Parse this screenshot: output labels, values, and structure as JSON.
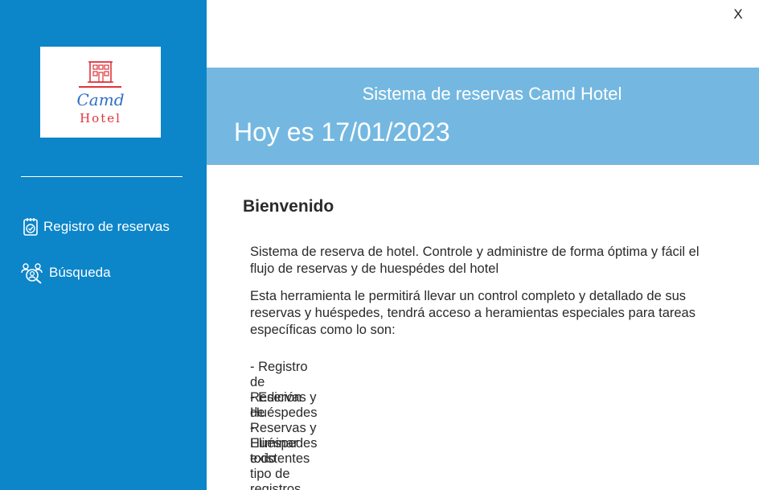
{
  "sidebar": {
    "logo": {
      "line1": "Camd",
      "line2": "Hotel"
    },
    "items": [
      {
        "label": "Registro de reservas",
        "icon": "clipboard-check-icon"
      },
      {
        "label": "Búsqueda",
        "icon": "users-search-icon"
      }
    ]
  },
  "window": {
    "close_label": "X"
  },
  "header": {
    "title": "Sistema de reservas Camd Hotel",
    "date": "Hoy es 17/01/2023"
  },
  "main": {
    "welcome": "Bienvenido",
    "paragraphs": [
      "Sistema de reserva de hotel. Controle y administre de forma óptima y fácil el flujo de reservas y de huespédes del hotel",
      "Esta herramienta le permitirá llevar un control completo y detallado de sus reservas y huéspedes, tendrá acceso a heramientas especiales para tareas específicas como lo son:"
    ],
    "bullets": [
      "- Registro de Reservas y Huéspedes",
      "- Edición de Reservas y Huéspedes existentes",
      "- Eliminar todo tipo de registros"
    ]
  },
  "colors": {
    "sidebar": "#0c85c9",
    "header": "#74b8e1",
    "logo_red": "#e0333a",
    "logo_blue": "#2f6fc4"
  }
}
